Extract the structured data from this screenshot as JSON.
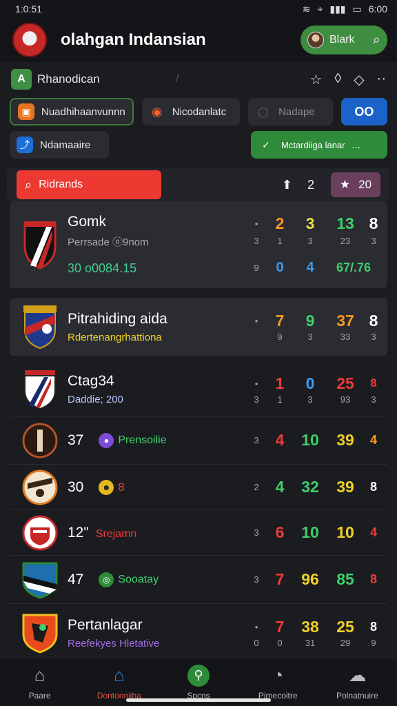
{
  "status_bar": {
    "time": "1:0:51",
    "battery": "6:00"
  },
  "header": {
    "title": "olahgan Indansian",
    "search_label": "Blark"
  },
  "toolbar": {
    "badge": "A",
    "label": "Rhanodican"
  },
  "chips_row1": [
    {
      "label": "Nuadhihaanvunnn"
    },
    {
      "label": "Nicodanlatc"
    },
    {
      "label": "Nadape"
    },
    {
      "label": "OO"
    }
  ],
  "chips_row2": [
    {
      "label": "Ndamaaire"
    },
    {
      "label": "Mctardiiga lanar",
      "suffix": "..."
    }
  ],
  "filter": {
    "search_placeholder": "Ridrands",
    "count": "2",
    "star_count": "20"
  },
  "teams": [
    {
      "name": "Gomk",
      "sub": "Perrsade ⓞ9nom",
      "sub2": "30  o0084.15",
      "stats": [
        [
          "2",
          "3",
          "13",
          "8"
        ],
        [
          "1",
          "3",
          "23",
          "3"
        ]
      ],
      "extra_stats": [
        "9",
        "0",
        "4",
        "67/.76"
      ]
    },
    {
      "name": "Pitrahiding aida",
      "sub": "Rdertenangrhattiona",
      "stats": [
        [
          "7",
          "9",
          "37",
          "8"
        ],
        [
          "9",
          "3",
          "33",
          "3"
        ]
      ]
    },
    {
      "name": "Ctag34",
      "sub": "Daddie; 200",
      "stats": [
        [
          "1",
          "0",
          "25",
          "8"
        ],
        [
          "1",
          "3",
          "93",
          "3"
        ]
      ]
    },
    {
      "name": "37",
      "sub": "Prensoilie",
      "stats": [
        [
          "4",
          "10",
          "39",
          "4"
        ]
      ],
      "lead": "3"
    },
    {
      "name": "30",
      "sub": "8",
      "stats": [
        [
          "4",
          "32",
          "39",
          "8"
        ]
      ],
      "lead": "2"
    },
    {
      "name": "12\"",
      "sub": "Srejamn",
      "stats": [
        [
          "6",
          "10",
          "10",
          "4"
        ]
      ],
      "lead": "3"
    },
    {
      "name": "47",
      "sub": "Sooatay",
      "stats": [
        [
          "7",
          "96",
          "85",
          "8"
        ]
      ],
      "lead": "3"
    },
    {
      "name": "Pertanlagar",
      "sub": "Reefekyes Hletative",
      "stats": [
        [
          "7",
          "38",
          "25",
          "8"
        ],
        [
          "0",
          "31",
          "29",
          "9"
        ]
      ],
      "lead": "0"
    }
  ],
  "nav": [
    {
      "label": "Paare"
    },
    {
      "label": "Dontonniiha"
    },
    {
      "label": "Spcns"
    },
    {
      "label": "Pimecoitre"
    },
    {
      "label": "Polnatnuire"
    }
  ]
}
